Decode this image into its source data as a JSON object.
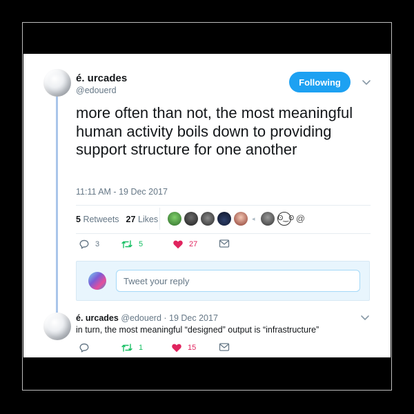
{
  "tweet": {
    "author_name": "é. urcades",
    "author_handle": "@edouerd",
    "follow_label": "Following",
    "text": "more often than not, the most meaningful human activity boils down to providing support structure for one another",
    "timestamp": "11:11 AM - 19 Dec 2017",
    "retweets_count": "5",
    "retweets_label": "Retweets",
    "likes_count": "27",
    "likes_label": "Likes",
    "actions": {
      "reply_count": "3",
      "retweet_count": "5",
      "like_count": "27"
    }
  },
  "reply_composer": {
    "placeholder": "Tweet your reply"
  },
  "reply": {
    "author_name": "é. urcades",
    "author_handle": "@edouerd",
    "date": "19 Dec 2017",
    "text": "in turn, the most meaningful “designed” output is “infrastructure”",
    "actions": {
      "reply_count": "",
      "retweet_count": "1",
      "like_count": "15"
    }
  },
  "colors": {
    "accent": "#1da1f2",
    "retweet_green": "#17bf63",
    "like_red": "#e0245e",
    "muted": "#657786"
  },
  "icons": [
    "reply-icon",
    "retweet-icon",
    "heart-icon",
    "message-icon",
    "chevron-down-icon"
  ]
}
